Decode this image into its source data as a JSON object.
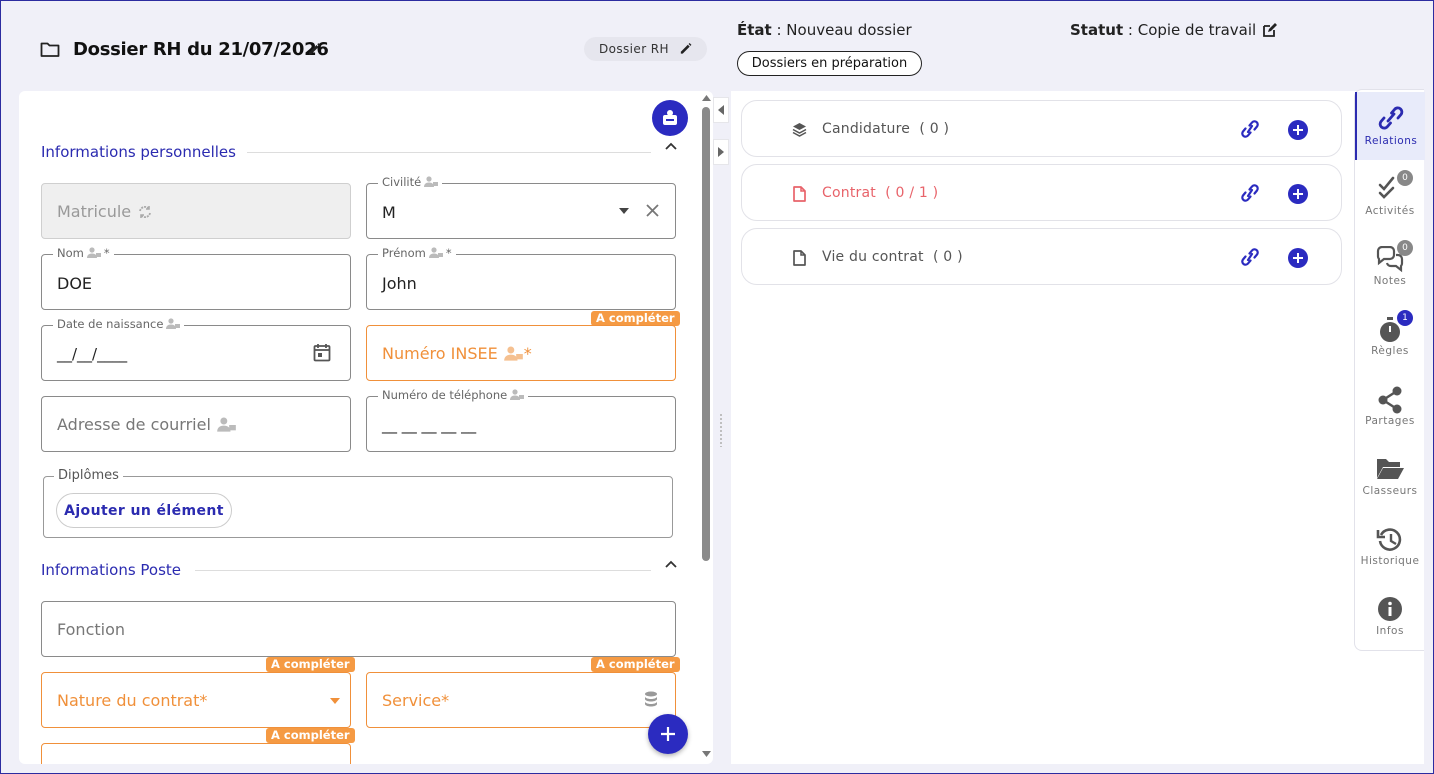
{
  "header": {
    "title": "Dossier RH du 21/07/2026",
    "type_chip": "Dossier RH",
    "etat_label": "État",
    "etat_value": " : Nouveau dossier",
    "statut_label": "Statut",
    "statut_value": " : Copie de travail",
    "status_chip": "Dossiers en préparation"
  },
  "form": {
    "section_personal": "Informations personnelles",
    "section_poste": "Informations Poste",
    "warn_badge": "A compléter",
    "matricule": {
      "placeholder": "Matricule"
    },
    "civilite": {
      "label": "Civilité",
      "value": "M"
    },
    "nom": {
      "label": "Nom",
      "required": "*",
      "value": "DOE"
    },
    "prenom": {
      "label": "Prénom",
      "required": "*",
      "value": "John"
    },
    "date_naissance": {
      "label": "Date de naissance",
      "value": "__/__/____"
    },
    "insee": {
      "placeholder": "Numéro INSEE",
      "required": "*"
    },
    "courriel": {
      "placeholder": "Adresse de courriel"
    },
    "telephone": {
      "label": "Numéro de téléphone",
      "value": "__ __ __ __ __"
    },
    "diplomes": {
      "label": "Diplômes",
      "add_button": "Ajouter un élément"
    },
    "fonction": {
      "placeholder": "Fonction"
    },
    "nature_contrat": {
      "placeholder": "Nature du contrat*"
    },
    "service": {
      "placeholder": "Service*"
    }
  },
  "relations": [
    {
      "label": "Candidature",
      "count": "( 0 )",
      "color": "#555555"
    },
    {
      "label": "Contrat",
      "count": "( 0 / 1 )",
      "color": "#e8636a"
    },
    {
      "label": "Vie du contrat",
      "count": "( 0 )",
      "color": "#555555"
    }
  ],
  "sidebar": {
    "items": [
      {
        "label": "Relations",
        "icon": "relations-link-icon"
      },
      {
        "label": "Activités",
        "icon": "check-list-icon",
        "badge": "0"
      },
      {
        "label": "Notes",
        "icon": "chat-bubbles-icon",
        "badge": "0"
      },
      {
        "label": "Règles",
        "icon": "timer-icon",
        "badge": "1"
      },
      {
        "label": "Partages",
        "icon": "share-icon"
      },
      {
        "label": "Classeurs",
        "icon": "folder-open-icon"
      },
      {
        "label": "Historique",
        "icon": "history-icon"
      },
      {
        "label": "Infos",
        "icon": "info-icon"
      }
    ]
  },
  "colors": {
    "accent": "#2b2bb0",
    "warning": "#f0903a",
    "danger": "#e8636a"
  }
}
